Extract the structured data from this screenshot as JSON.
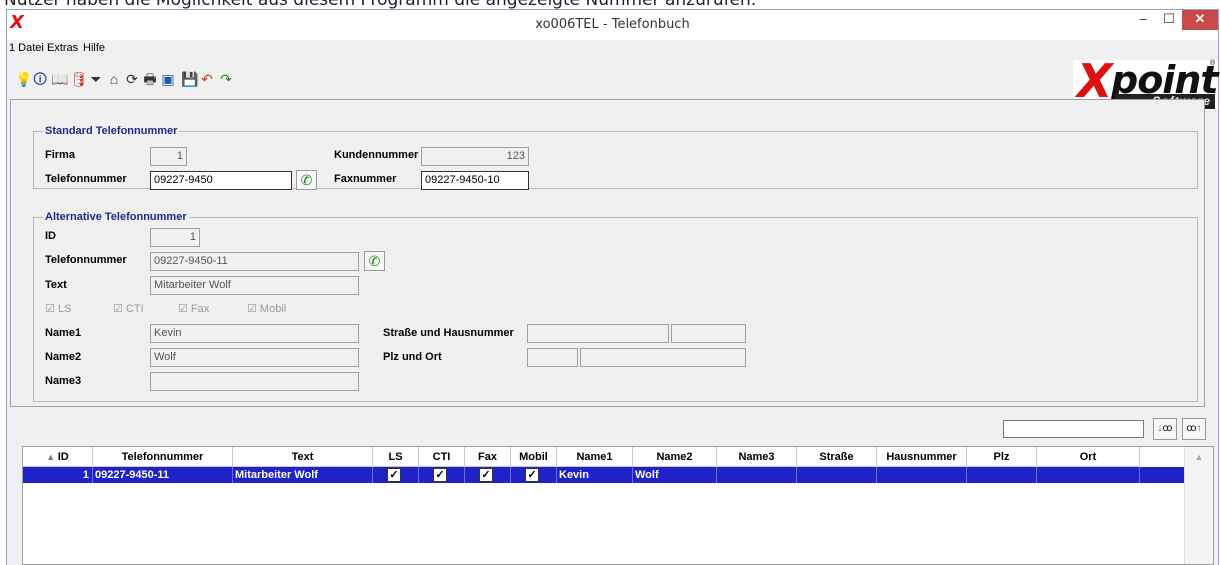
{
  "caption": "Nutzer haben die Möglichkeit aus diesem Programm die angezeigte Nummer anzurufen.",
  "window": {
    "title": "xo006TEL - Telefonbuch",
    "app_icon": "X",
    "minimize": "–",
    "maximize": "☐",
    "close": "✕"
  },
  "menu": [
    "1 Datei",
    "Extras",
    "Hilfe"
  ],
  "toolbar_icons": [
    "lightbulb-icon",
    "info-icon",
    "book-icon",
    "database-icon",
    "filter-icon",
    "home-icon",
    "refresh-icon",
    "print-icon",
    "window-icon",
    "save-icon",
    "undo-icon",
    "redo-icon"
  ],
  "toolbar_glyphs": [
    "💡",
    "🛈",
    "📖",
    "🛢",
    "⏷",
    "⌂",
    "⟳",
    "🖶",
    "▣",
    "💾",
    "↶",
    "↷"
  ],
  "logo": {
    "mark": "X",
    "word": "point",
    "sub": "Software",
    "reg": "®"
  },
  "standard": {
    "legend": "Standard Telefonnummer",
    "firma_label": "Firma",
    "firma_value": "1",
    "kundennummer_label": "Kundennummer",
    "kundennummer_value": "123",
    "telefon_label": "Telefonnummer",
    "telefon_value": "09227-9450",
    "fax_label": "Faxnummer",
    "fax_value": "09227-9450-10"
  },
  "alternative": {
    "legend": "Alternative Telefonnummer",
    "id_label": "ID",
    "id_value": "1",
    "telefon_label": "Telefonnummer",
    "telefon_value": "09227-9450-11",
    "text_label": "Text",
    "text_value": "Mitarbeiter Wolf",
    "checks": [
      {
        "label": "LS",
        "checked": true
      },
      {
        "label": "CTI",
        "checked": true
      },
      {
        "label": "Fax",
        "checked": true
      },
      {
        "label": "Mobil",
        "checked": true
      }
    ],
    "name1_label": "Name1",
    "name1_value": "Kevin",
    "name2_label": "Name2",
    "name2_value": "Wolf",
    "name3_label": "Name3",
    "name3_value": "",
    "strasse_label": "Straße und Hausnummer",
    "plz_label": "Plz und Ort"
  },
  "search": {
    "value": "",
    "find_down": "↓",
    "find_up": "↑"
  },
  "grid": {
    "sort_indicator": "▲",
    "columns": [
      "ID",
      "Telefonnummer",
      "Text",
      "LS",
      "CTI",
      "Fax",
      "Mobil",
      "Name1",
      "Name2",
      "Name3",
      "Straße",
      "Hausnummer",
      "Plz",
      "Ort"
    ],
    "rows": [
      {
        "ID": "1",
        "Telefonnummer": "09227-9450-11",
        "Text": "Mitarbeiter Wolf",
        "LS": "✓",
        "CTI": "✓",
        "Fax": "✓",
        "Mobil": "✓",
        "Name1": "Kevin",
        "Name2": "Wolf",
        "Name3": "",
        "Straße": "",
        "Hausnummer": "",
        "Plz": "",
        "Ort": ""
      }
    ]
  },
  "colors": {
    "selection": "#1f21c9",
    "legend": "#1b2b89",
    "logo_red": "#dd1111",
    "phone_green": "#1a8a1a"
  }
}
